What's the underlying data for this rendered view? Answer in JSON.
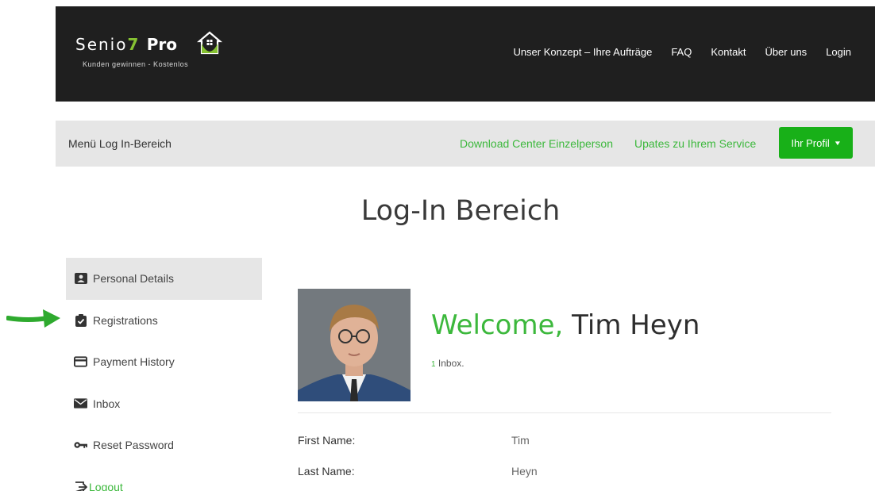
{
  "header": {
    "brand_prefix": "Senio",
    "brand_seven": "7",
    "brand_pro": "Pro",
    "tagline": "Kunden gewinnen - Kostenlos",
    "nav": [
      {
        "label": "Unser Konzept – Ihre Aufträge"
      },
      {
        "label": "FAQ"
      },
      {
        "label": "Kontakt"
      },
      {
        "label": "Über uns"
      },
      {
        "label": "Login"
      }
    ]
  },
  "subbar": {
    "title": "Menü Log In-Bereich",
    "links": [
      {
        "label": "Download Center Einzelperson"
      },
      {
        "label": "Upates zu Ihrem Service"
      }
    ],
    "profile_button": "Ihr Profil"
  },
  "page_title": "Log-In Bereich",
  "sidebar": {
    "items": [
      {
        "label": "Personal Details",
        "icon": "id-card-icon",
        "active": true
      },
      {
        "label": "Registrations",
        "icon": "clipboard-check-icon"
      },
      {
        "label": "Payment History",
        "icon": "credit-card-icon"
      },
      {
        "label": "Inbox",
        "icon": "envelope-icon"
      },
      {
        "label": "Reset Password",
        "icon": "key-icon"
      },
      {
        "label": "Logout",
        "icon": "sign-out-icon"
      }
    ]
  },
  "main": {
    "welcome_prefix": "Welcome,",
    "user_name": "Tim Heyn",
    "inbox_count": "1",
    "inbox_label": "Inbox.",
    "fields": [
      {
        "label": "First Name:",
        "value": "Tim"
      },
      {
        "label": "Last Name:",
        "value": "Heyn"
      }
    ]
  },
  "colors": {
    "accent": "#3cb83c",
    "header_bg": "#1f1f1f",
    "subbar_bg": "#e6e6e6",
    "button": "#18b018"
  }
}
